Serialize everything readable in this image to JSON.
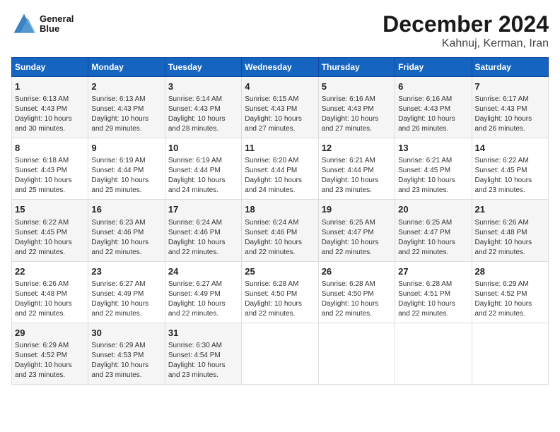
{
  "logo": {
    "line1": "General",
    "line2": "Blue"
  },
  "title": "December 2024",
  "subtitle": "Kahnuj, Kerman, Iran",
  "days_of_week": [
    "Sunday",
    "Monday",
    "Tuesday",
    "Wednesday",
    "Thursday",
    "Friday",
    "Saturday"
  ],
  "weeks": [
    [
      {
        "day": "1",
        "sunrise": "Sunrise: 6:13 AM",
        "sunset": "Sunset: 4:43 PM",
        "daylight": "Daylight: 10 hours and 30 minutes."
      },
      {
        "day": "2",
        "sunrise": "Sunrise: 6:13 AM",
        "sunset": "Sunset: 4:43 PM",
        "daylight": "Daylight: 10 hours and 29 minutes."
      },
      {
        "day": "3",
        "sunrise": "Sunrise: 6:14 AM",
        "sunset": "Sunset: 4:43 PM",
        "daylight": "Daylight: 10 hours and 28 minutes."
      },
      {
        "day": "4",
        "sunrise": "Sunrise: 6:15 AM",
        "sunset": "Sunset: 4:43 PM",
        "daylight": "Daylight: 10 hours and 27 minutes."
      },
      {
        "day": "5",
        "sunrise": "Sunrise: 6:16 AM",
        "sunset": "Sunset: 4:43 PM",
        "daylight": "Daylight: 10 hours and 27 minutes."
      },
      {
        "day": "6",
        "sunrise": "Sunrise: 6:16 AM",
        "sunset": "Sunset: 4:43 PM",
        "daylight": "Daylight: 10 hours and 26 minutes."
      },
      {
        "day": "7",
        "sunrise": "Sunrise: 6:17 AM",
        "sunset": "Sunset: 4:43 PM",
        "daylight": "Daylight: 10 hours and 26 minutes."
      }
    ],
    [
      {
        "day": "8",
        "sunrise": "Sunrise: 6:18 AM",
        "sunset": "Sunset: 4:43 PM",
        "daylight": "Daylight: 10 hours and 25 minutes."
      },
      {
        "day": "9",
        "sunrise": "Sunrise: 6:19 AM",
        "sunset": "Sunset: 4:44 PM",
        "daylight": "Daylight: 10 hours and 25 minutes."
      },
      {
        "day": "10",
        "sunrise": "Sunrise: 6:19 AM",
        "sunset": "Sunset: 4:44 PM",
        "daylight": "Daylight: 10 hours and 24 minutes."
      },
      {
        "day": "11",
        "sunrise": "Sunrise: 6:20 AM",
        "sunset": "Sunset: 4:44 PM",
        "daylight": "Daylight: 10 hours and 24 minutes."
      },
      {
        "day": "12",
        "sunrise": "Sunrise: 6:21 AM",
        "sunset": "Sunset: 4:44 PM",
        "daylight": "Daylight: 10 hours and 23 minutes."
      },
      {
        "day": "13",
        "sunrise": "Sunrise: 6:21 AM",
        "sunset": "Sunset: 4:45 PM",
        "daylight": "Daylight: 10 hours and 23 minutes."
      },
      {
        "day": "14",
        "sunrise": "Sunrise: 6:22 AM",
        "sunset": "Sunset: 4:45 PM",
        "daylight": "Daylight: 10 hours and 23 minutes."
      }
    ],
    [
      {
        "day": "15",
        "sunrise": "Sunrise: 6:22 AM",
        "sunset": "Sunset: 4:45 PM",
        "daylight": "Daylight: 10 hours and 22 minutes."
      },
      {
        "day": "16",
        "sunrise": "Sunrise: 6:23 AM",
        "sunset": "Sunset: 4:46 PM",
        "daylight": "Daylight: 10 hours and 22 minutes."
      },
      {
        "day": "17",
        "sunrise": "Sunrise: 6:24 AM",
        "sunset": "Sunset: 4:46 PM",
        "daylight": "Daylight: 10 hours and 22 minutes."
      },
      {
        "day": "18",
        "sunrise": "Sunrise: 6:24 AM",
        "sunset": "Sunset: 4:46 PM",
        "daylight": "Daylight: 10 hours and 22 minutes."
      },
      {
        "day": "19",
        "sunrise": "Sunrise: 6:25 AM",
        "sunset": "Sunset: 4:47 PM",
        "daylight": "Daylight: 10 hours and 22 minutes."
      },
      {
        "day": "20",
        "sunrise": "Sunrise: 6:25 AM",
        "sunset": "Sunset: 4:47 PM",
        "daylight": "Daylight: 10 hours and 22 minutes."
      },
      {
        "day": "21",
        "sunrise": "Sunrise: 6:26 AM",
        "sunset": "Sunset: 4:48 PM",
        "daylight": "Daylight: 10 hours and 22 minutes."
      }
    ],
    [
      {
        "day": "22",
        "sunrise": "Sunrise: 6:26 AM",
        "sunset": "Sunset: 4:48 PM",
        "daylight": "Daylight: 10 hours and 22 minutes."
      },
      {
        "day": "23",
        "sunrise": "Sunrise: 6:27 AM",
        "sunset": "Sunset: 4:49 PM",
        "daylight": "Daylight: 10 hours and 22 minutes."
      },
      {
        "day": "24",
        "sunrise": "Sunrise: 6:27 AM",
        "sunset": "Sunset: 4:49 PM",
        "daylight": "Daylight: 10 hours and 22 minutes."
      },
      {
        "day": "25",
        "sunrise": "Sunrise: 6:28 AM",
        "sunset": "Sunset: 4:50 PM",
        "daylight": "Daylight: 10 hours and 22 minutes."
      },
      {
        "day": "26",
        "sunrise": "Sunrise: 6:28 AM",
        "sunset": "Sunset: 4:50 PM",
        "daylight": "Daylight: 10 hours and 22 minutes."
      },
      {
        "day": "27",
        "sunrise": "Sunrise: 6:28 AM",
        "sunset": "Sunset: 4:51 PM",
        "daylight": "Daylight: 10 hours and 22 minutes."
      },
      {
        "day": "28",
        "sunrise": "Sunrise: 6:29 AM",
        "sunset": "Sunset: 4:52 PM",
        "daylight": "Daylight: 10 hours and 22 minutes."
      }
    ],
    [
      {
        "day": "29",
        "sunrise": "Sunrise: 6:29 AM",
        "sunset": "Sunset: 4:52 PM",
        "daylight": "Daylight: 10 hours and 23 minutes."
      },
      {
        "day": "30",
        "sunrise": "Sunrise: 6:29 AM",
        "sunset": "Sunset: 4:53 PM",
        "daylight": "Daylight: 10 hours and 23 minutes."
      },
      {
        "day": "31",
        "sunrise": "Sunrise: 6:30 AM",
        "sunset": "Sunset: 4:54 PM",
        "daylight": "Daylight: 10 hours and 23 minutes."
      },
      null,
      null,
      null,
      null
    ]
  ]
}
